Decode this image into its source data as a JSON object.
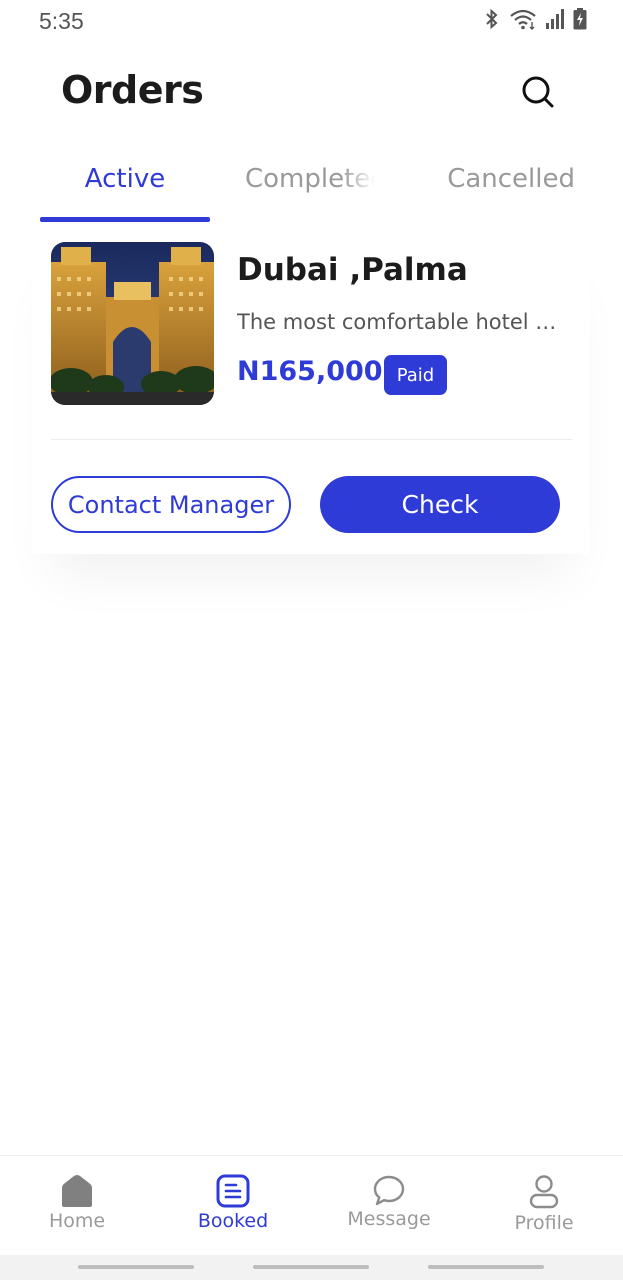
{
  "status_bar": {
    "time": "5:35",
    "icons": [
      "bluetooth-icon",
      "wifi-icon",
      "signal-icon",
      "battery-charging-icon"
    ]
  },
  "header": {
    "title": "Orders",
    "search_icon": "search-icon"
  },
  "tabs": [
    {
      "label": "Active",
      "active": true
    },
    {
      "label": "Completed",
      "active": false
    },
    {
      "label": "Cancelled",
      "active": false
    }
  ],
  "order": {
    "name": "Dubai ,Palma",
    "description": "The most comfortable hotel in Dubai",
    "price": "N165,000",
    "status": "Paid",
    "contact_label": "Contact Manager",
    "check_label": "Check"
  },
  "bottom_nav": [
    {
      "label": "Home",
      "icon": "home-icon",
      "active": false
    },
    {
      "label": "Booked",
      "icon": "booked-icon",
      "active": true
    },
    {
      "label": "Message",
      "icon": "message-icon",
      "active": false
    },
    {
      "label": "Profile",
      "icon": "profile-icon",
      "active": false
    }
  ],
  "colors": {
    "accent": "#2f3bd6",
    "text": "#1c1c1c",
    "muted": "#9a9a9a"
  }
}
